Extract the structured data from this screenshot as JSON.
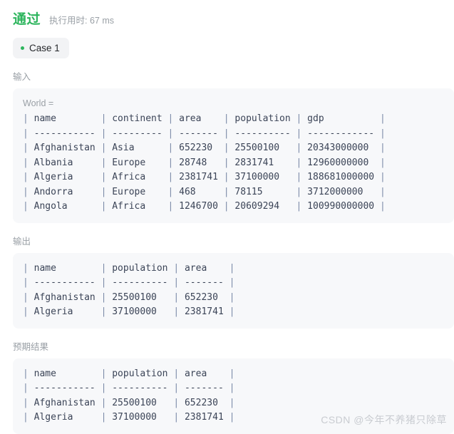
{
  "header": {
    "verdict": "通过",
    "verdict_color": "#2db55d",
    "runtime_label": "执行用时: 67 ms"
  },
  "cases": {
    "items": [
      {
        "label": "Case 1",
        "dot_color": "#2db55d",
        "selected": true
      }
    ]
  },
  "sections": {
    "input": {
      "label": "输入",
      "caption": "World =",
      "table": {
        "headers": [
          "name",
          "continent",
          "area",
          "population",
          "gdp"
        ],
        "widths": [
          11,
          9,
          7,
          10,
          12
        ],
        "rows": [
          [
            "Afghanistan",
            "Asia",
            "652230",
            "25500100",
            "20343000000"
          ],
          [
            "Albania",
            "Europe",
            "28748",
            "2831741",
            "12960000000"
          ],
          [
            "Algeria",
            "Africa",
            "2381741",
            "37100000",
            "188681000000"
          ],
          [
            "Andorra",
            "Europe",
            "468",
            "78115",
            "3712000000"
          ],
          [
            "Angola",
            "Africa",
            "1246700",
            "20609294",
            "100990000000"
          ]
        ]
      }
    },
    "output": {
      "label": "输出",
      "caption": "",
      "table": {
        "headers": [
          "name",
          "population",
          "area"
        ],
        "widths": [
          11,
          10,
          7
        ],
        "rows": [
          [
            "Afghanistan",
            "25500100",
            "652230"
          ],
          [
            "Algeria",
            "37100000",
            "2381741"
          ]
        ]
      }
    },
    "expected": {
      "label": "预期结果",
      "caption": "",
      "table": {
        "headers": [
          "name",
          "population",
          "area"
        ],
        "widths": [
          11,
          10,
          7
        ],
        "rows": [
          [
            "Afghanistan",
            "25500100",
            "652230"
          ],
          [
            "Algeria",
            "37100000",
            "2381741"
          ]
        ]
      }
    }
  },
  "watermark": {
    "text": "CSDN @今年不养猪只除草"
  }
}
